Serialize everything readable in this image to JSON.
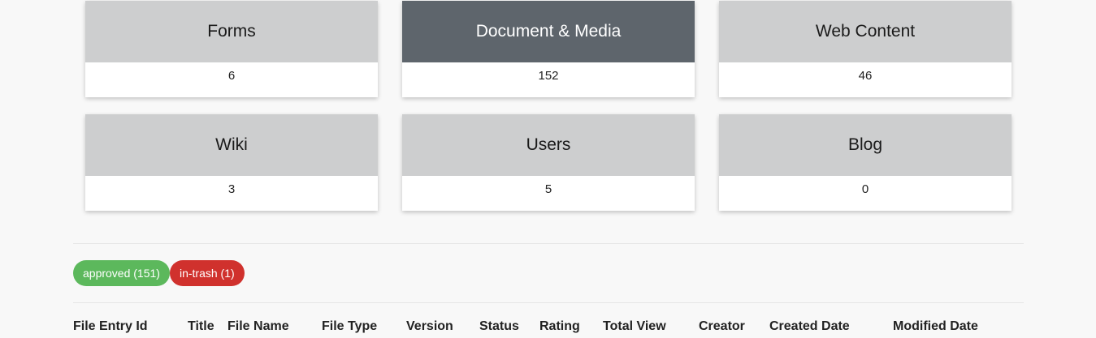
{
  "cards": [
    {
      "title": "Forms",
      "count": "6",
      "active": false
    },
    {
      "title": "Document & Media",
      "count": "152",
      "active": true
    },
    {
      "title": "Web Content",
      "count": "46",
      "active": false
    },
    {
      "title": "Wiki",
      "count": "3",
      "active": false
    },
    {
      "title": "Users",
      "count": "5",
      "active": false
    },
    {
      "title": "Blog",
      "count": "0",
      "active": false
    }
  ],
  "status_filters": {
    "approved": "approved (151)",
    "in_trash": "in-trash (1)"
  },
  "table": {
    "columns": [
      "File Entry Id",
      "Title",
      "File Name",
      "File Type",
      "Version",
      "Status",
      "Rating",
      "Total View",
      "Creator",
      "Created Date",
      "Modified Date"
    ]
  },
  "colors": {
    "card_header": "#cdcecf",
    "card_header_active": "#5e656c",
    "approved": "#5cb85c",
    "in_trash": "#d0312d"
  }
}
